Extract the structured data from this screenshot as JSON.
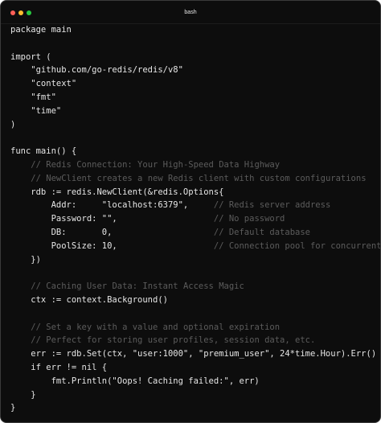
{
  "window": {
    "title": "bash",
    "controls": [
      {
        "name": "close-button",
        "color": "#ff5f57"
      },
      {
        "name": "minimize-button",
        "color": "#febc2e"
      },
      {
        "name": "maximize-button",
        "color": "#28c840"
      }
    ]
  },
  "colors": {
    "background": "#0d0d0d",
    "text": "#e6e6e6",
    "comment": "#5c5c5c"
  },
  "code": {
    "lines": [
      {
        "code": "package main",
        "comment": ""
      },
      {
        "code": "",
        "comment": ""
      },
      {
        "code": "import (",
        "comment": ""
      },
      {
        "code": "    \"github.com/go-redis/redis/v8\"",
        "comment": ""
      },
      {
        "code": "    \"context\"",
        "comment": ""
      },
      {
        "code": "    \"fmt\"",
        "comment": ""
      },
      {
        "code": "    \"time\"",
        "comment": ""
      },
      {
        "code": ")",
        "comment": ""
      },
      {
        "code": "",
        "comment": ""
      },
      {
        "code": "func main() {",
        "comment": ""
      },
      {
        "code": "    ",
        "comment": "// Redis Connection: Your High-Speed Data Highway"
      },
      {
        "code": "    ",
        "comment": "// NewClient creates a new Redis client with custom configurations"
      },
      {
        "code": "    rdb := redis.NewClient(&redis.Options{",
        "comment": ""
      },
      {
        "code": "        Addr:     \"localhost:6379\",     ",
        "comment": "// Redis server address"
      },
      {
        "code": "        Password: \"\",                   ",
        "comment": "// No password"
      },
      {
        "code": "        DB:       0,                    ",
        "comment": "// Default database"
      },
      {
        "code": "        PoolSize: 10,                   ",
        "comment": "// Connection pool for concurrent access"
      },
      {
        "code": "    })",
        "comment": ""
      },
      {
        "code": "",
        "comment": ""
      },
      {
        "code": "    ",
        "comment": "// Caching User Data: Instant Access Magic"
      },
      {
        "code": "    ctx := context.Background()",
        "comment": ""
      },
      {
        "code": "",
        "comment": ""
      },
      {
        "code": "    ",
        "comment": "// Set a key with a value and optional expiration"
      },
      {
        "code": "    ",
        "comment": "// Perfect for storing user profiles, session data, etc."
      },
      {
        "code": "    err := rdb.Set(ctx, \"user:1000\", \"premium_user\", 24*time.Hour).Err()",
        "comment": ""
      },
      {
        "code": "    if err != nil {",
        "comment": ""
      },
      {
        "code": "        fmt.Println(\"Oops! Caching failed:\", err)",
        "comment": ""
      },
      {
        "code": "    }",
        "comment": ""
      },
      {
        "code": "}",
        "comment": ""
      }
    ]
  }
}
